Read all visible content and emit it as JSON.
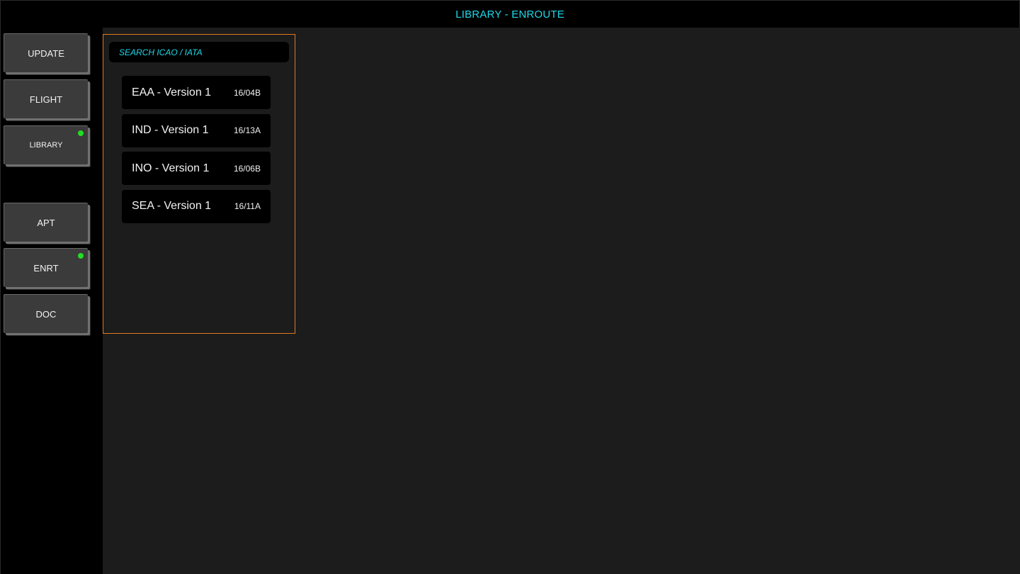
{
  "header": {
    "title": "LIBRARY - ENROUTE"
  },
  "sidebar": {
    "buttons": [
      {
        "label": "UPDATE"
      },
      {
        "label": "FLIGHT"
      },
      {
        "label": "LIBRARY",
        "status": "active"
      },
      {
        "label": "APT"
      },
      {
        "label": "ENRT",
        "status": "active"
      },
      {
        "label": "DOC"
      }
    ]
  },
  "search": {
    "placeholder": "SEARCH ICAO / IATA",
    "value": ""
  },
  "library_items": [
    {
      "name": "EAA - Version 1",
      "code": "16/04B"
    },
    {
      "name": "IND - Version 1",
      "code": "16/13A"
    },
    {
      "name": "INO - Version 1",
      "code": "16/06B"
    },
    {
      "name": "SEA - Version 1",
      "code": "16/11A"
    }
  ],
  "colors": {
    "accent_cyan": "#1ed8e8",
    "panel_border": "#e07a22",
    "status_green": "#22dd22",
    "background": "#1c1c1c"
  }
}
